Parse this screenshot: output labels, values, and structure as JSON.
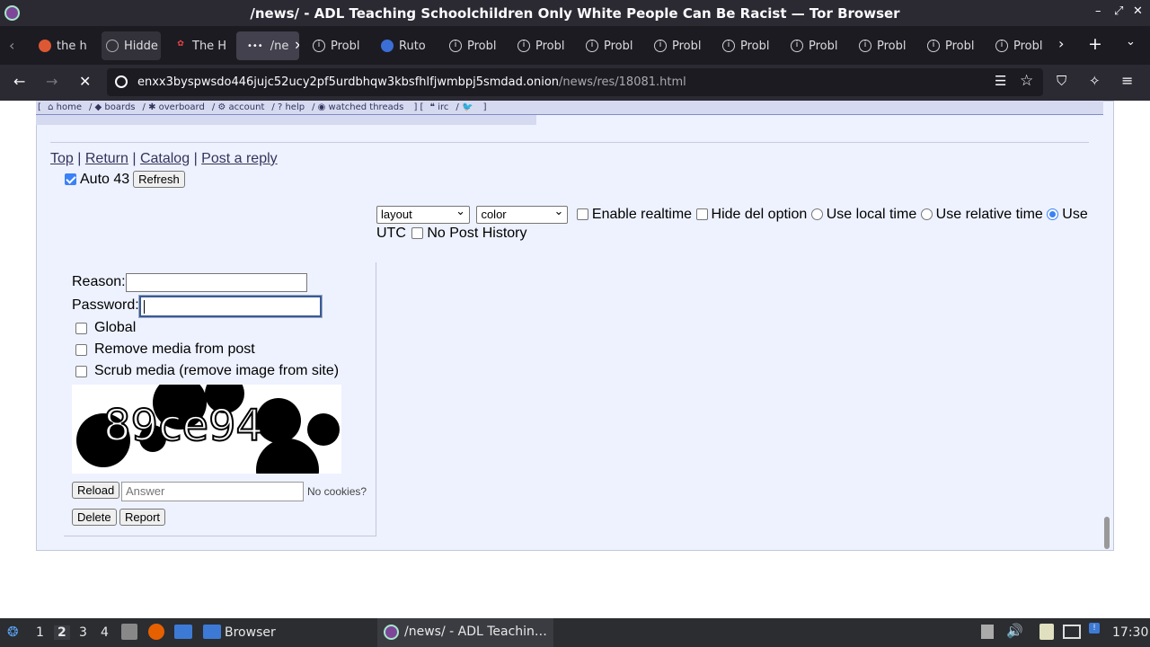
{
  "window": {
    "title": "/news/ - ADL Teaching Schoolchildren Only White People Can Be Racist — Tor Browser",
    "controls": [
      "–",
      "⤢",
      "✕"
    ]
  },
  "tabs": [
    {
      "label": "the h",
      "icon": "duckduckgo-icon"
    },
    {
      "label": "Hidde",
      "icon": "onion-icon"
    },
    {
      "label": "The H",
      "icon": "bow-icon"
    },
    {
      "label": "/ne",
      "icon": "loading-icon",
      "active": true
    },
    {
      "label": "Probl",
      "icon": "info-icon"
    },
    {
      "label": "Ruto",
      "icon": "tor-icon"
    },
    {
      "label": "Probl",
      "icon": "info-icon"
    },
    {
      "label": "Probl",
      "icon": "info-icon"
    },
    {
      "label": "Probl",
      "icon": "info-icon"
    },
    {
      "label": "Probl",
      "icon": "info-icon"
    },
    {
      "label": "Probl",
      "icon": "info-icon"
    },
    {
      "label": "Probl",
      "icon": "info-icon"
    },
    {
      "label": "Probl",
      "icon": "info-icon"
    },
    {
      "label": "Probl",
      "icon": "info-icon"
    },
    {
      "label": "Probl",
      "icon": "info-icon"
    }
  ],
  "url": {
    "host": "enxx3byspwsdo446jujc52ucy2pf5urdbhqw3kbsfhlfjwmbpj5smdad.onion",
    "path": "/news/res/18081.html"
  },
  "topnav": {
    "home": "home",
    "boards": "boards",
    "overboard": "overboard",
    "account": "account",
    "help": "help",
    "watched": "watched threads",
    "irc": "irc",
    "twitter": "🐦"
  },
  "thread_links": {
    "top": "Top",
    "return": "Return",
    "catalog": "Catalog",
    "reply": "Post a reply",
    "sep": "|"
  },
  "auto": {
    "label": "Auto 43",
    "checked": true,
    "refresh": "Refresh"
  },
  "options": {
    "layout": "layout",
    "color": "color",
    "realtime": "Enable realtime",
    "hide_del": "Hide del option",
    "local_time": "Use local time",
    "relative_time": "Use relative time",
    "utc_1": "Use",
    "utc_2": "UTC",
    "no_history": "No Post History"
  },
  "delete_form": {
    "reason_label": "Reason:",
    "reason_value": "",
    "password_label": "Password:",
    "password_value": "",
    "global": "Global",
    "remove_media": "Remove media from post",
    "scrub_media": "Scrub media (remove image from site)",
    "captcha_text": "89ce94",
    "reload": "Reload",
    "answer_placeholder": "Answer",
    "no_cookies": "No cookies?",
    "delete": "Delete",
    "report": "Report"
  },
  "taskbar": {
    "workspaces": [
      "1",
      "2",
      "3",
      "4"
    ],
    "browser_label": "Browser",
    "window_label": "/news/ - ADL Teachin…",
    "time": "17:30"
  }
}
